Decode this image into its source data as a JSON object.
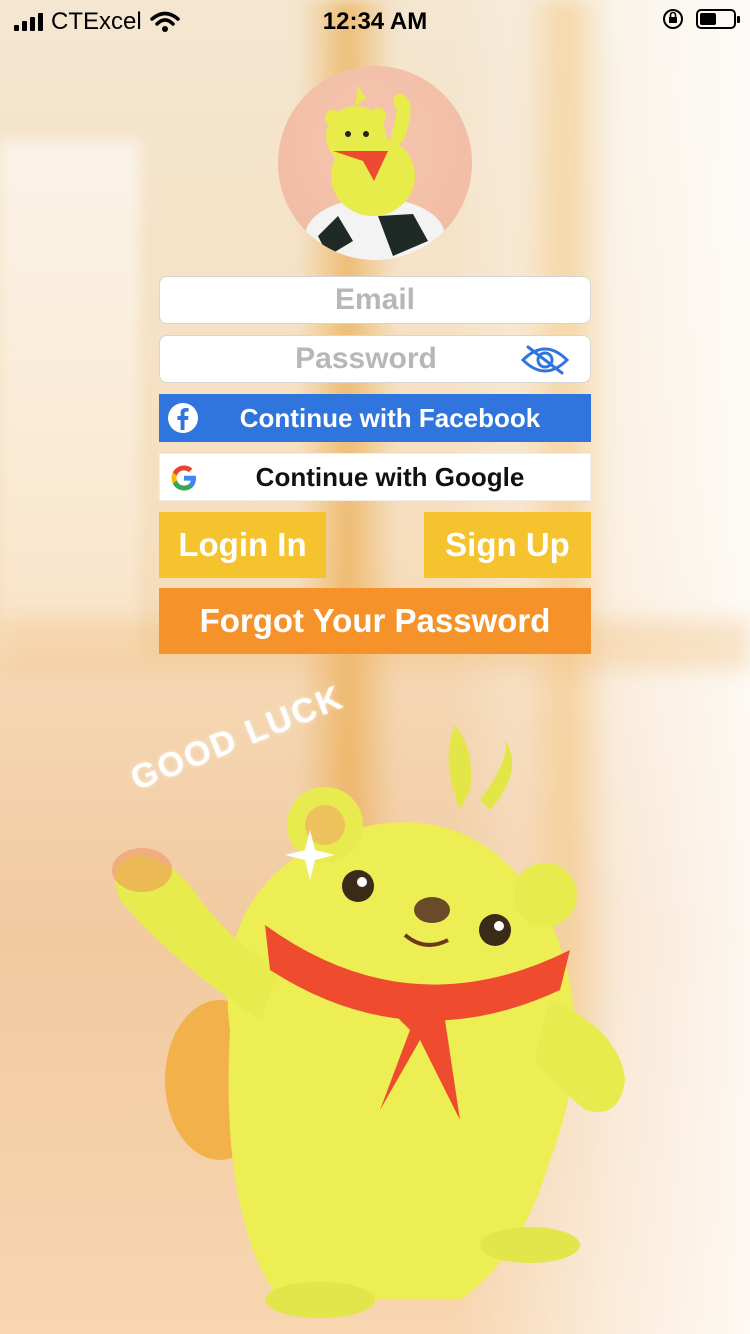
{
  "status_bar": {
    "carrier": "CTExcel",
    "time": "12:34 AM",
    "icons": [
      "signal-icon",
      "wifi-icon",
      "orientation-lock-icon",
      "battery-icon"
    ]
  },
  "avatar": {
    "icon": "bear-mascot-avatar"
  },
  "form": {
    "email_placeholder": "Email",
    "password_placeholder": "Password",
    "toggle_visibility_icon": "eye-slash-icon"
  },
  "sso": {
    "facebook_label": "Continue with Facebook",
    "google_label": "Continue with Google"
  },
  "actions": {
    "login_label": "Login In",
    "signup_label": "Sign Up",
    "forgot_label": "Forgot Your Password"
  },
  "decor": {
    "good_luck": "GOOD LUCK"
  },
  "colors": {
    "facebook": "#2f75dd",
    "yellow_button": "#f5c32d",
    "orange_button": "#f5932a",
    "eye_icon": "#2f75dd"
  }
}
